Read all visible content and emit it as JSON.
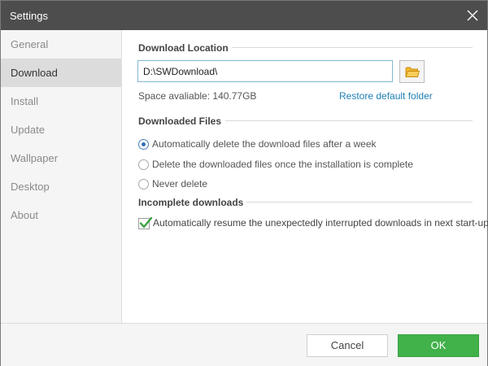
{
  "window": {
    "title": "Settings"
  },
  "sidebar": {
    "items": [
      {
        "label": "General"
      },
      {
        "label": "Download",
        "active": true
      },
      {
        "label": "Install"
      },
      {
        "label": "Update"
      },
      {
        "label": "Wallpaper"
      },
      {
        "label": "Desktop"
      },
      {
        "label": "About"
      }
    ]
  },
  "download_location": {
    "heading": "Download Location",
    "path_value": "D:\\SWDownload\\",
    "space_available": "Space avaliable: 140.77GB",
    "restore_link": "Restore default folder",
    "browse_icon": "folder-icon"
  },
  "downloaded_files": {
    "heading": "Downloaded Files",
    "options": [
      {
        "label": "Automatically delete the download files after a week",
        "checked": true
      },
      {
        "label": "Delete the downloaded files once the installation is complete",
        "checked": false
      },
      {
        "label": "Never delete",
        "checked": false
      }
    ]
  },
  "incomplete_downloads": {
    "heading": "Incomplete downloads",
    "option": {
      "label": "Automatically resume the unexpectedly interrupted downloads in next start-up.",
      "checked": true
    }
  },
  "footer": {
    "cancel_label": "Cancel",
    "ok_label": "OK"
  },
  "colors": {
    "titlebar": "#4d4d4d",
    "accent_green": "#41b14a",
    "link_blue": "#1e7fb6",
    "selected_item": "#dcdcdc"
  }
}
